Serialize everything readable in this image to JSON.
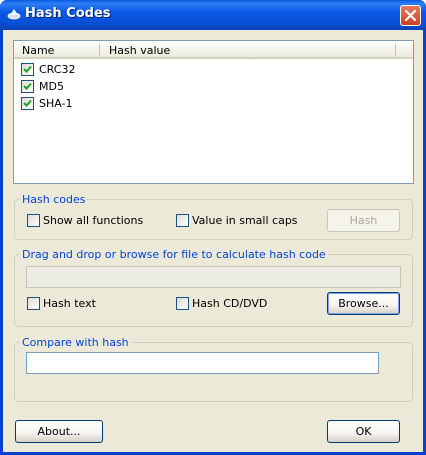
{
  "window": {
    "title": "Hash Codes"
  },
  "list": {
    "columns": [
      "Name",
      "Hash value"
    ],
    "items": [
      {
        "name": "CRC32",
        "checked": true
      },
      {
        "name": "MD5",
        "checked": true
      },
      {
        "name": "SHA-1",
        "checked": true
      }
    ]
  },
  "hash_codes": {
    "title": "Hash codes",
    "show_all_functions": "Show all functions",
    "small_caps": "Value in small caps",
    "hash_button": "Hash"
  },
  "file": {
    "title": "Drag and drop or browse for file to calculate hash code",
    "path_value": "",
    "hash_text": "Hash text",
    "hash_cd": "Hash CD/DVD",
    "browse_button": "Browse..."
  },
  "compare": {
    "title": "Compare with hash",
    "value": ""
  },
  "footer": {
    "about_button": "About...",
    "ok_button": "OK"
  },
  "colors": {
    "accent": "#0046d5",
    "titlebar": "#0b58e6"
  },
  "icons": {
    "title": "app-icon",
    "close": "close-icon",
    "check": "checkmark-icon"
  }
}
